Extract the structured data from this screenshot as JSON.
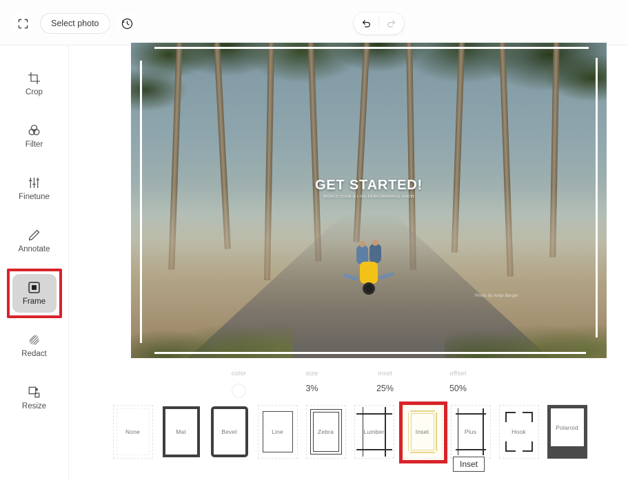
{
  "topbar": {
    "expand_icon": "fullscreen-icon",
    "select_photo_label": "Select photo",
    "history_icon": "history-revert-icon",
    "undo_label": "undo-icon",
    "redo_label": "redo-icon"
  },
  "sidebar": {
    "items": [
      {
        "label": "Crop",
        "icon": "crop-icon",
        "active": false
      },
      {
        "label": "Filter",
        "icon": "filter-icon",
        "active": false
      },
      {
        "label": "Finetune",
        "icon": "sliders-icon",
        "active": false
      },
      {
        "label": "Annotate",
        "icon": "pencil-icon",
        "active": false
      },
      {
        "label": "Frame",
        "icon": "frame-icon",
        "active": true
      },
      {
        "label": "Redact",
        "icon": "hatch-icon",
        "active": false
      },
      {
        "label": "Resize",
        "icon": "resize-icon",
        "active": false
      }
    ]
  },
  "canvas": {
    "photo_title": "GET STARTED!",
    "photo_subtitle": "WORLD TOUR & LIVE PERFORMANCE SHOW",
    "photo_credit": "Photo by Andy Berger",
    "frame_overlay": "inset"
  },
  "controls": [
    {
      "label": "color",
      "value": "",
      "type": "swatch",
      "swatch_color": "#ffffff"
    },
    {
      "label": "size",
      "value": "3%",
      "type": "text"
    },
    {
      "label": "inset",
      "value": "25%",
      "type": "text"
    },
    {
      "label": "offset",
      "value": "50%",
      "type": "text"
    }
  ],
  "frames": [
    {
      "label": "None",
      "style": "f-none",
      "selected": false
    },
    {
      "label": "Mat",
      "style": "f-mat",
      "selected": false
    },
    {
      "label": "Bevel",
      "style": "f-bevel",
      "selected": false
    },
    {
      "label": "Line",
      "style": "f-line",
      "selected": false
    },
    {
      "label": "Zebra",
      "style": "f-zebra",
      "selected": false
    },
    {
      "label": "Lumber",
      "style": "f-lumber",
      "selected": false
    },
    {
      "label": "Inset",
      "style": "f-inset",
      "selected": true
    },
    {
      "label": "Plus",
      "style": "f-plus",
      "selected": false
    },
    {
      "label": "Hook",
      "style": "f-hook",
      "selected": false
    },
    {
      "label": "Polaroid",
      "style": "f-polaroid",
      "selected": false
    }
  ],
  "tooltip": {
    "text": "Inset"
  },
  "colors": {
    "selection_red": "#d8232a",
    "active_tool_bg": "#d6d6d6",
    "inset_frame_yellow": "#e8d48a"
  }
}
